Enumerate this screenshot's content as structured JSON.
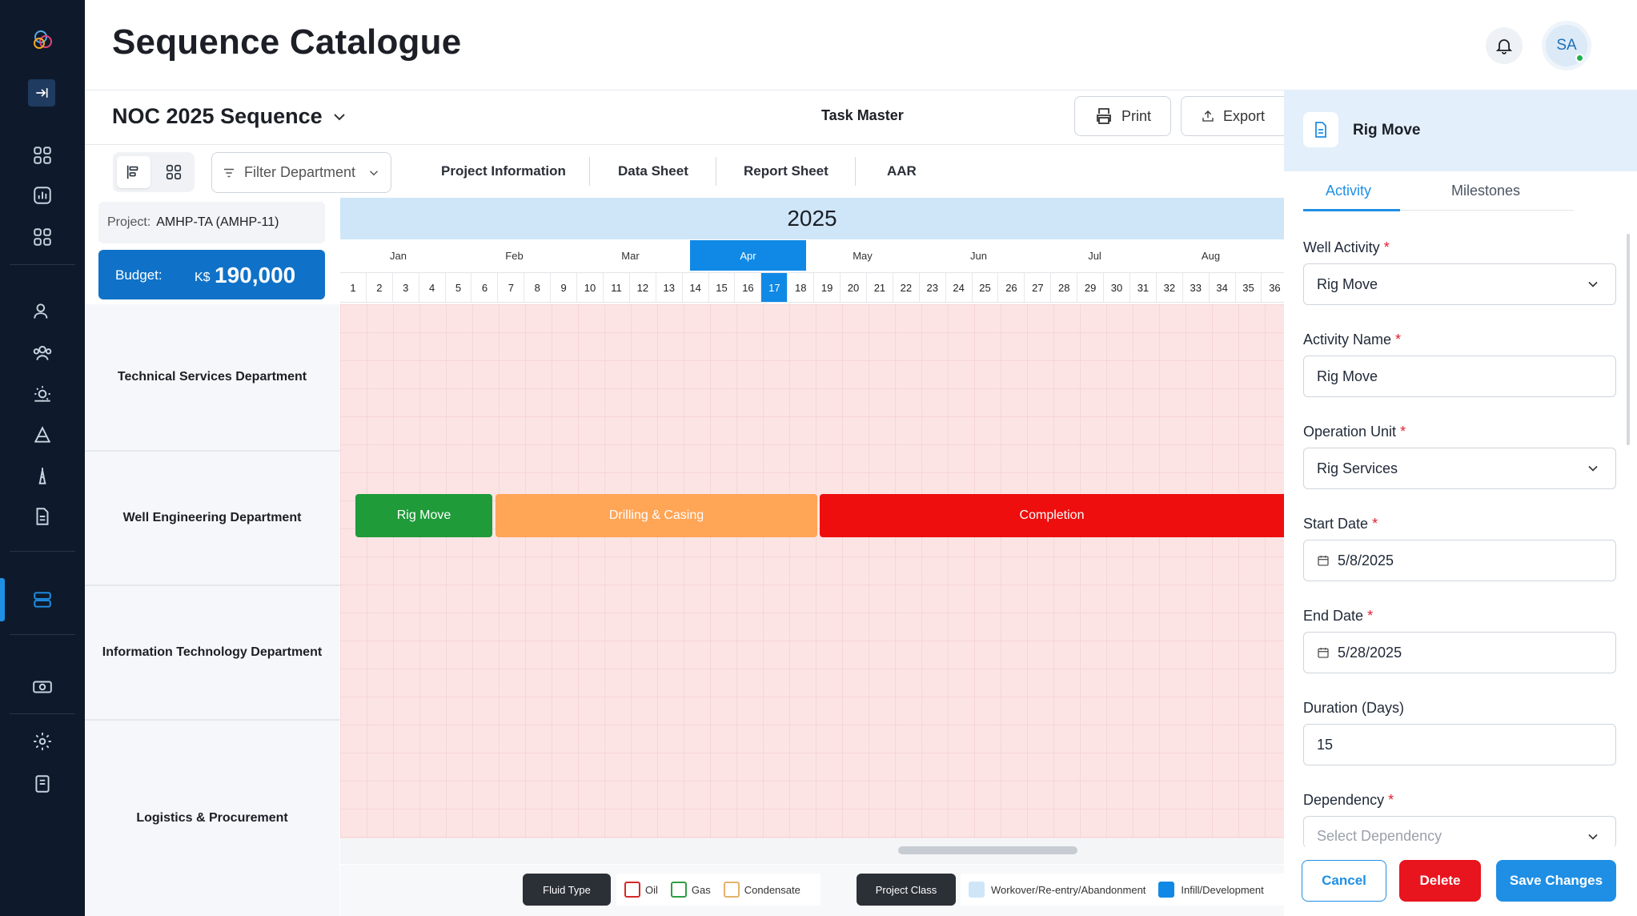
{
  "header": {
    "title": "Sequence Catalogue",
    "avatar_initials": "SA"
  },
  "sidebar": {
    "icons": [
      "logo-icon",
      "collapse-icon",
      "dashboard-icon",
      "analytics-icon",
      "apps-icon",
      "user-icon",
      "team-icon",
      "weather-icon",
      "rig-chart-icon",
      "tower-icon",
      "document-icon",
      "sequence-icon",
      "budget-icon",
      "settings-icon",
      "notes-icon"
    ],
    "active_item": "sequence-icon"
  },
  "sequence": {
    "selected": "NOC 2025 Sequence",
    "task_master_label": "Task Master",
    "print_label": "Print",
    "export_label": "Export"
  },
  "toolbar": {
    "filter_placeholder": "Filter Department",
    "tabs": [
      "Project Information",
      "Data Sheet",
      "Report Sheet",
      "AAR"
    ]
  },
  "project": {
    "label": "Project:",
    "value": "AMHP-TA (AMHP-11)",
    "budget_label": "Budget:",
    "budget_currency": "K$",
    "budget_value": "190,000"
  },
  "departments": [
    "Technical Services Department",
    "Well Engineering Department",
    "Information Technology Department",
    "Logistics & Procurement"
  ],
  "timeline": {
    "year": "2025",
    "months": [
      "Jan",
      "Feb",
      "Mar",
      "Apr",
      "May",
      "Jun",
      "Jul",
      "Aug"
    ],
    "active_month": "Apr",
    "weeks": [
      "1",
      "2",
      "3",
      "4",
      "5",
      "6",
      "7",
      "8",
      "9",
      "10",
      "11",
      "12",
      "13",
      "14",
      "15",
      "16",
      "17",
      "18",
      "19",
      "20",
      "21",
      "22",
      "23",
      "24",
      "25",
      "26",
      "27",
      "28",
      "29",
      "30",
      "31",
      "32",
      "33",
      "34",
      "35",
      "36"
    ],
    "active_week": "17",
    "activities": [
      {
        "label": "Rig Move",
        "color": "#1f9b3a",
        "department": "Well Engineering Department"
      },
      {
        "label": "Drilling & Casing",
        "color": "#ffa556",
        "department": "Well Engineering Department"
      },
      {
        "label": "Completion",
        "color": "#ee0e0e",
        "department": "Well Engineering Department"
      }
    ]
  },
  "legend": {
    "fluid_type_label": "Fluid Type",
    "fluid_types": [
      {
        "label": "Oil",
        "color": "#d62828"
      },
      {
        "label": "Gas",
        "color": "#2f9e44"
      },
      {
        "label": "Condensate",
        "color": "#e3b36b"
      }
    ],
    "project_class_label": "Project Class",
    "project_classes": [
      {
        "label": "Workover/Re-entry/Abandonment",
        "color": "#cfe6f8"
      },
      {
        "label": "Infill/Development",
        "color": "#1089e6"
      }
    ]
  },
  "panel": {
    "title": "Rig Move",
    "tabs": [
      "Activity",
      "Milestones"
    ],
    "active_tab": "Activity",
    "fields": {
      "well_activity": {
        "label": "Well Activity",
        "value": "Rig Move",
        "required": "*"
      },
      "activity_name": {
        "label": "Activity Name",
        "value": "Rig Move",
        "required": "*"
      },
      "operation_unit": {
        "label": "Operation Unit",
        "value": "Rig Services",
        "required": "*"
      },
      "start_date": {
        "label": "Start Date",
        "value": "5/8/2025",
        "required": "*"
      },
      "end_date": {
        "label": "End Date",
        "value": "5/28/2025",
        "required": "*"
      },
      "duration": {
        "label": "Duration (Days)",
        "value": "15"
      },
      "dependency": {
        "label": "Dependency",
        "placeholder": "Select Dependency",
        "required": "*"
      }
    },
    "cancel_label": "Cancel",
    "delete_label": "Delete",
    "save_label": "Save Changes"
  }
}
